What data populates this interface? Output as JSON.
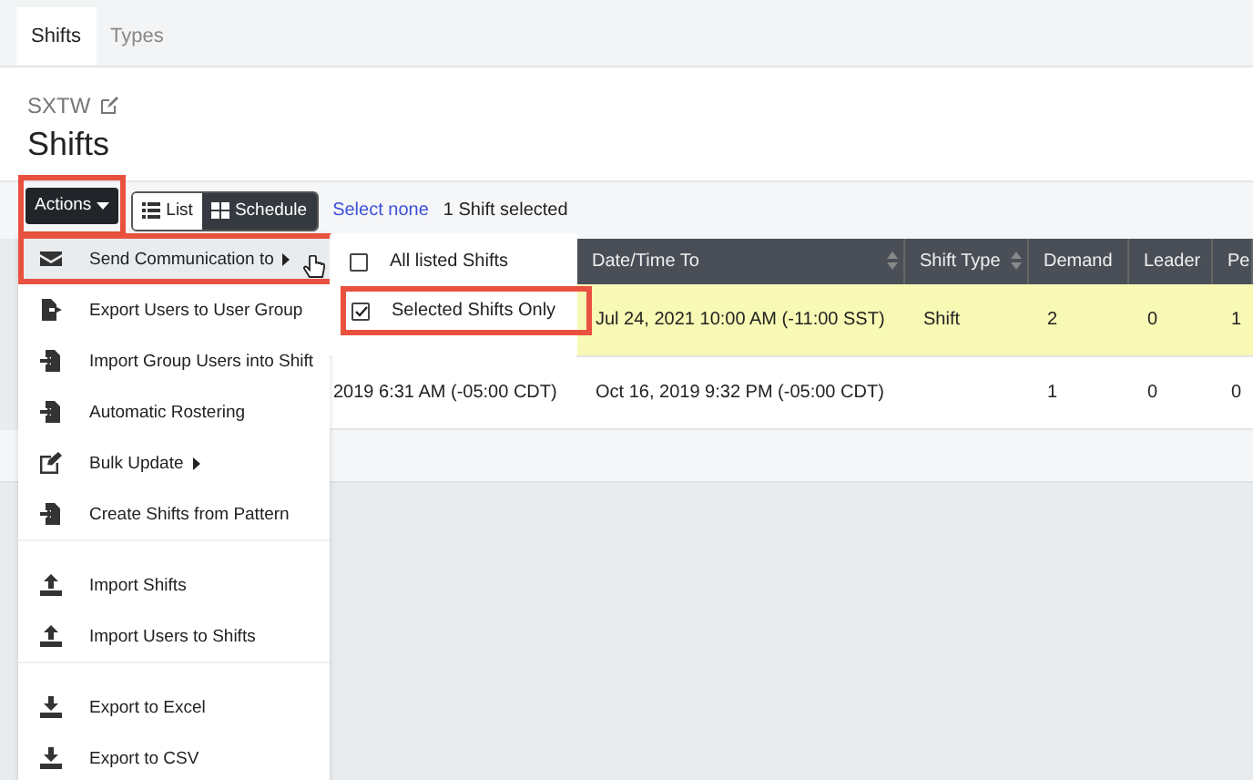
{
  "tabs": [
    {
      "label": "Shifts",
      "selected": true
    },
    {
      "label": "Types",
      "selected": false
    }
  ],
  "header": {
    "subtitle": "SXTW",
    "title": "Shifts"
  },
  "toolbar": {
    "actions_button": {
      "label": "Actions",
      "annotated": true
    },
    "view_toggle": [
      {
        "label": "List",
        "selected": false
      },
      {
        "label": "Schedule",
        "selected": true
      }
    ],
    "select_none_link": "Select none",
    "selection_count": "1 Shift selected"
  },
  "table": {
    "columns": [
      {
        "label": "Date/Time To",
        "sortable": true
      },
      {
        "label": "Shift Type",
        "sortable": true
      },
      {
        "label": "Demand",
        "sortable": false
      },
      {
        "label": "Leader",
        "sortable": false
      },
      {
        "label": "Pe",
        "sortable": false
      }
    ],
    "rows": [
      {
        "highlighted": true,
        "cells": [
          "Jul 24, 2021 10:00 AM (-11:00 SST)",
          "Shift",
          "2",
          "0",
          "1"
        ]
      },
      {
        "highlighted": false,
        "column_1": "2019 6:31 AM (-05:00 CDT)",
        "cells": [
          "Oct 16, 2019 9:32 PM (-05:00 CDT)",
          null,
          "1",
          "0",
          "0"
        ]
      }
    ]
  },
  "actions_menu": {
    "groups": [
      [
        {
          "label": "Send Communication to",
          "selected": true,
          "submenu": true,
          "annotated": true
        },
        {
          "label": "Export Users to User Group",
          "selected": false,
          "submenu": false,
          "annotated": false
        },
        {
          "label": "Import Group Users into Shift",
          "selected": false,
          "submenu": false,
          "annotated": false
        },
        {
          "label": "Automatic Rostering",
          "selected": false,
          "submenu": false,
          "annotated": false
        },
        {
          "label": "Bulk Update",
          "selected": false,
          "submenu": true,
          "annotated": false
        },
        {
          "label": "Create Shifts from Pattern",
          "selected": false,
          "submenu": false,
          "annotated": false
        }
      ],
      [
        {
          "label": "Import Shifts",
          "selected": false,
          "submenu": false,
          "annotated": false
        },
        {
          "label": "Import Users to Shifts",
          "selected": false,
          "submenu": false,
          "annotated": false
        }
      ],
      [
        {
          "label": "Export to Excel",
          "selected": false,
          "submenu": false,
          "annotated": false
        },
        {
          "label": "Export to CSV",
          "selected": false,
          "submenu": false,
          "annotated": false
        }
      ]
    ]
  },
  "submenu": {
    "items": [
      {
        "label": "All listed Shifts",
        "checked": false,
        "annotated": false
      },
      {
        "label": "Selected Shifts Only",
        "checked": true,
        "annotated": true
      }
    ]
  }
}
